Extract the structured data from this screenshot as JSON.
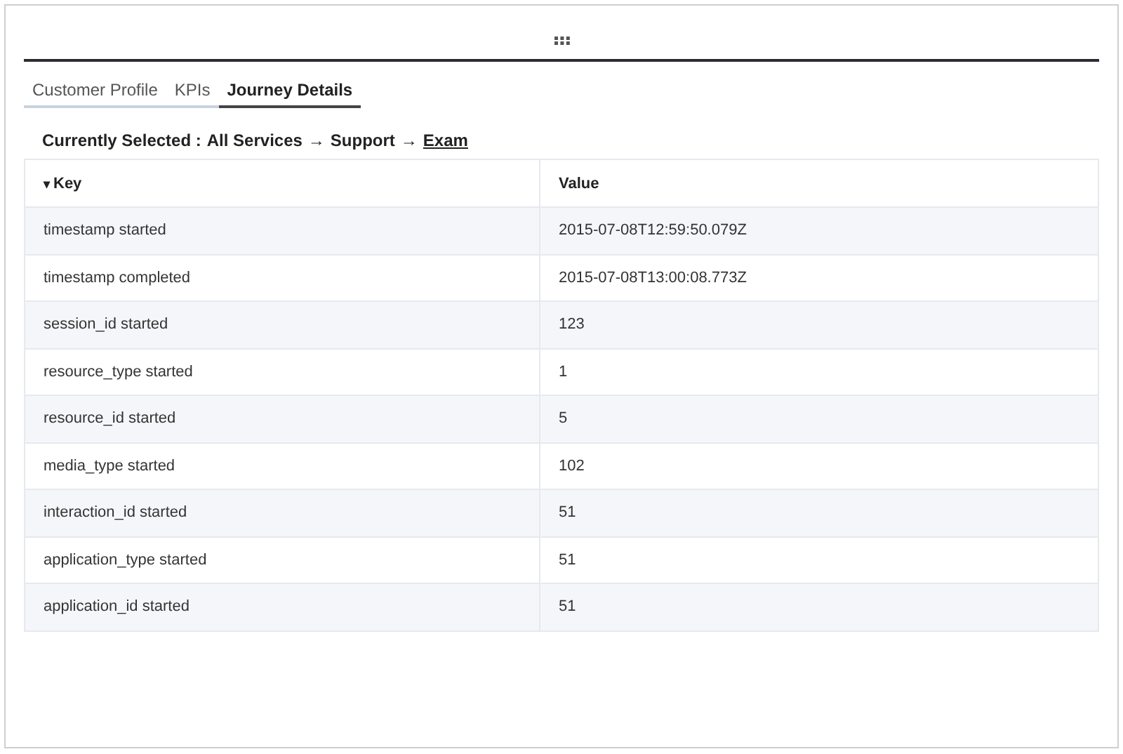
{
  "tabs": [
    {
      "label": "Customer Profile",
      "selected": false
    },
    {
      "label": "KPIs",
      "selected": false
    },
    {
      "label": "Journey Details",
      "selected": true
    }
  ],
  "breadcrumb": {
    "label": "Currently Selected :",
    "segments": [
      {
        "kind": "text",
        "text": "All Services"
      },
      {
        "kind": "arrow",
        "text": "→"
      },
      {
        "kind": "text",
        "text": "Support"
      },
      {
        "kind": "arrow",
        "text": "→"
      },
      {
        "kind": "link",
        "text": "Exam"
      }
    ]
  },
  "table": {
    "columns": [
      {
        "label": "Key",
        "sort_icon": "▾"
      },
      {
        "label": "Value"
      }
    ],
    "rows": [
      [
        "timestamp started",
        "2015-07-08T12:59:50.079Z"
      ],
      [
        "timestamp completed",
        "2015-07-08T13:00:08.773Z"
      ],
      [
        "session_id started",
        "123"
      ],
      [
        "resource_type started",
        "1"
      ],
      [
        "resource_id started",
        "5"
      ],
      [
        "media_type started",
        "102"
      ],
      [
        "interaction_id started",
        "51"
      ],
      [
        "application_type started",
        "51"
      ],
      [
        "application_id started",
        "51"
      ]
    ]
  }
}
